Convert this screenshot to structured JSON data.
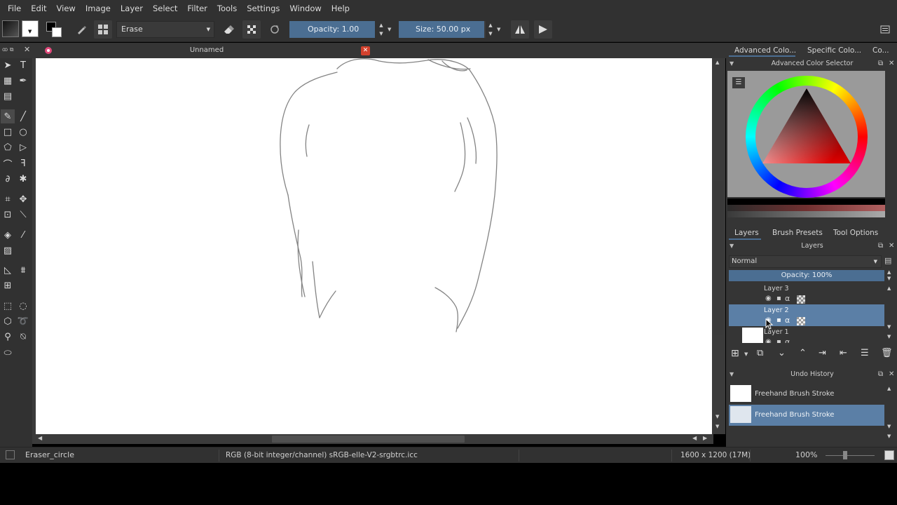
{
  "menu": [
    "File",
    "Edit",
    "View",
    "Image",
    "Layer",
    "Select",
    "Filter",
    "Tools",
    "Settings",
    "Window",
    "Help"
  ],
  "toolbar": {
    "blend_mode": "Erase",
    "opacity_label": "Opacity:",
    "opacity_value": "1.00",
    "size_label": "Size:",
    "size_value": "50.00 px"
  },
  "document": {
    "tab_title": "Unnamed"
  },
  "dock": {
    "top_tabs": [
      "Advanced Colo...",
      "Specific Colo...",
      "Co..."
    ],
    "color_selector_title": "Advanced Color Selector",
    "middle_tabs": [
      "Layers",
      "Brush Presets",
      "Tool Options"
    ],
    "layers_title": "Layers",
    "blend_mode": "Normal",
    "opacity_text": "Opacity:  100%",
    "layers": [
      {
        "name": "Layer 3",
        "selected": false
      },
      {
        "name": "Layer 2",
        "selected": true
      },
      {
        "name": "Layer 1",
        "selected": false
      }
    ],
    "undo_title": "Undo History",
    "undo_items": [
      {
        "label": "Freehand Brush Stroke",
        "selected": false
      },
      {
        "label": "Freehand Brush Stroke",
        "selected": true
      }
    ]
  },
  "status": {
    "brush": "Eraser_circle",
    "color_profile": "RGB (8-bit integer/channel)  sRGB-elle-V2-srgbtrc.icc",
    "image_size": "1600 x 1200 (17M)",
    "zoom": "100%"
  },
  "colors": {
    "accent": "#4b6e92",
    "selected_row": "#5b7fa6",
    "panel": "#353535",
    "chrome": "#313131"
  },
  "icons": [
    "eraser-icon",
    "alpha-lock-icon",
    "reset-icon",
    "mirror-horizontal-icon",
    "mirror-vertical-icon",
    "hamburger-icon",
    "eye-icon",
    "lock-icon",
    "add-layer-icon",
    "delete-icon"
  ]
}
